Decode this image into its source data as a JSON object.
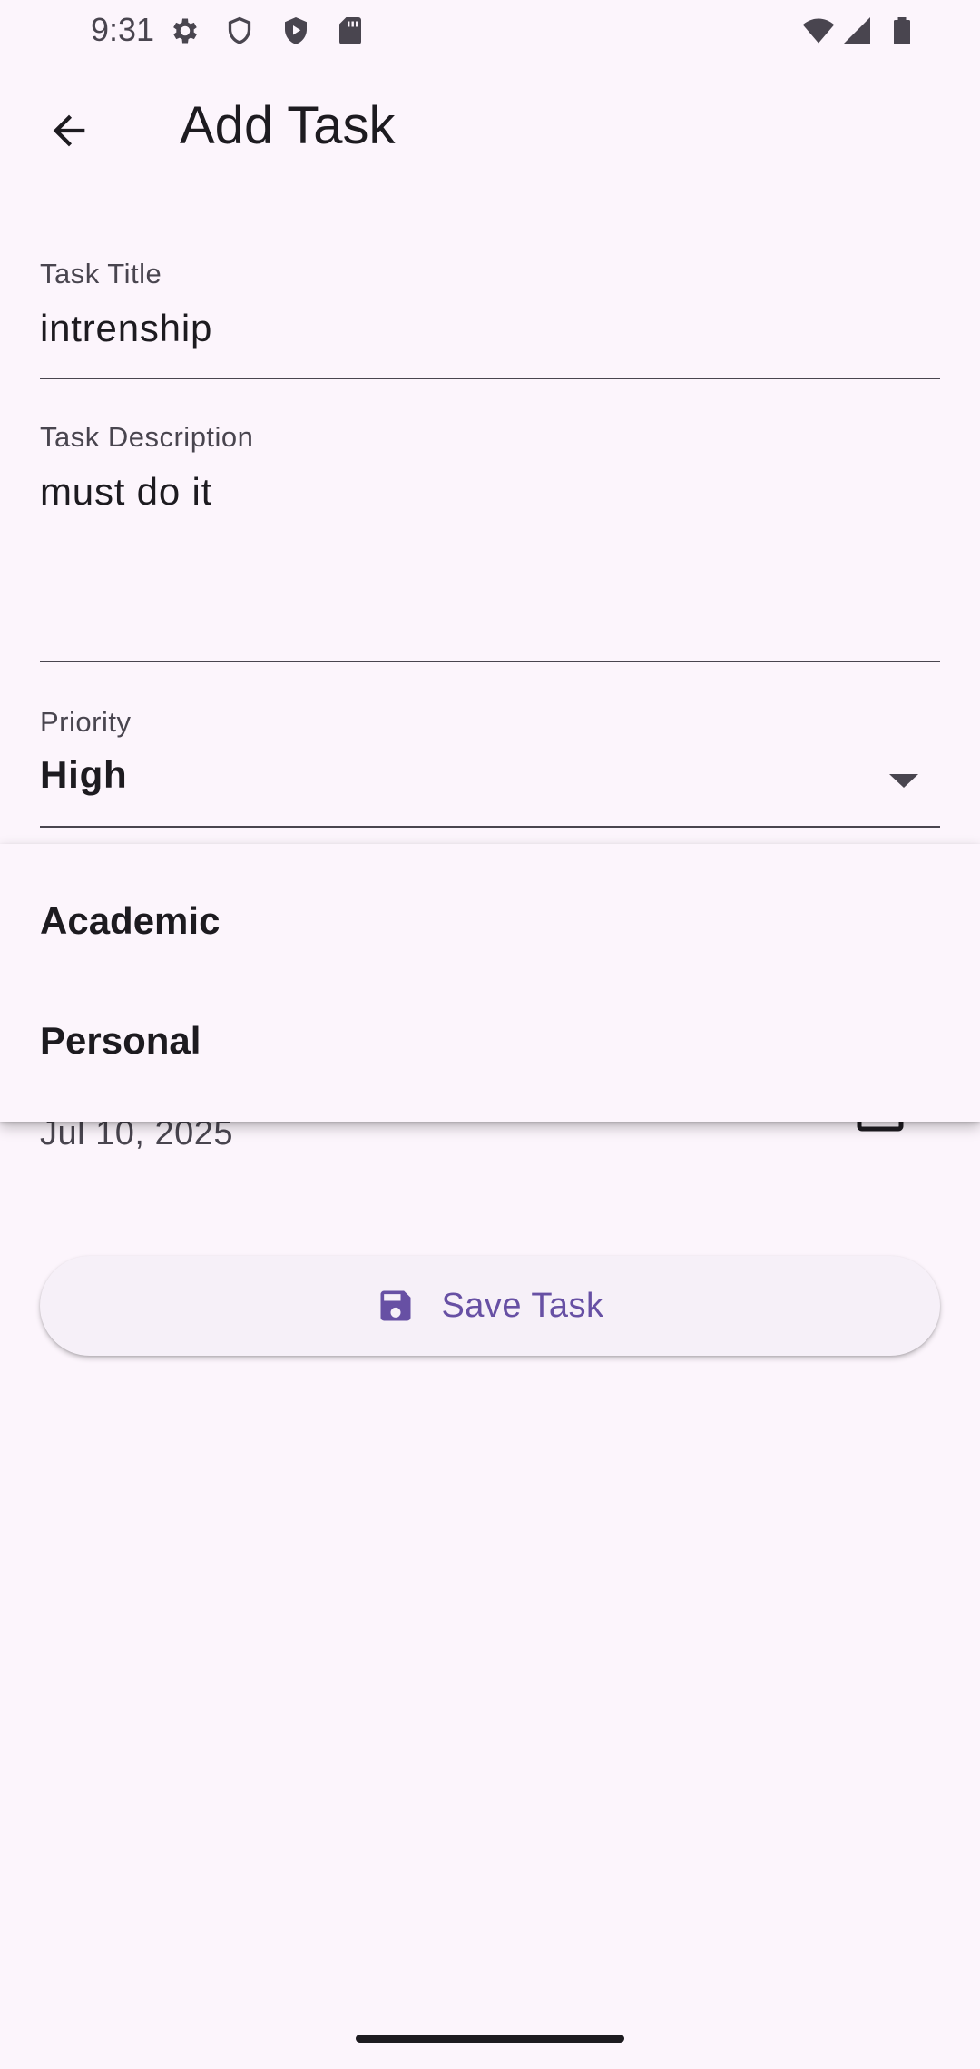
{
  "status_bar": {
    "time": "9:31",
    "left_icons": [
      "gear-icon",
      "shield-icon",
      "play-shield-icon",
      "sd-card-icon"
    ],
    "right_icons": [
      "wifi-icon",
      "signal-icon",
      "battery-icon"
    ]
  },
  "app_bar": {
    "back_icon": "arrow-back-icon",
    "title": "Add Task"
  },
  "form": {
    "title_field": {
      "label": "Task Title",
      "value": "intrenship"
    },
    "description_field": {
      "label": "Task Description",
      "value": "must do it"
    },
    "priority_field": {
      "label": "Priority",
      "value": "High",
      "icon": "arrow-drop-down-icon"
    },
    "date_value": "Jul 10, 2025",
    "date_icon": "calendar-icon"
  },
  "category_menu": {
    "options": [
      "Academic",
      "Personal"
    ]
  },
  "save_button": {
    "icon": "save-icon",
    "label": "Save Task"
  },
  "colors": {
    "background": "#fcf5fc",
    "accent": "#6750a4",
    "text": "#1d1b20",
    "secondary_text": "#49454f"
  }
}
